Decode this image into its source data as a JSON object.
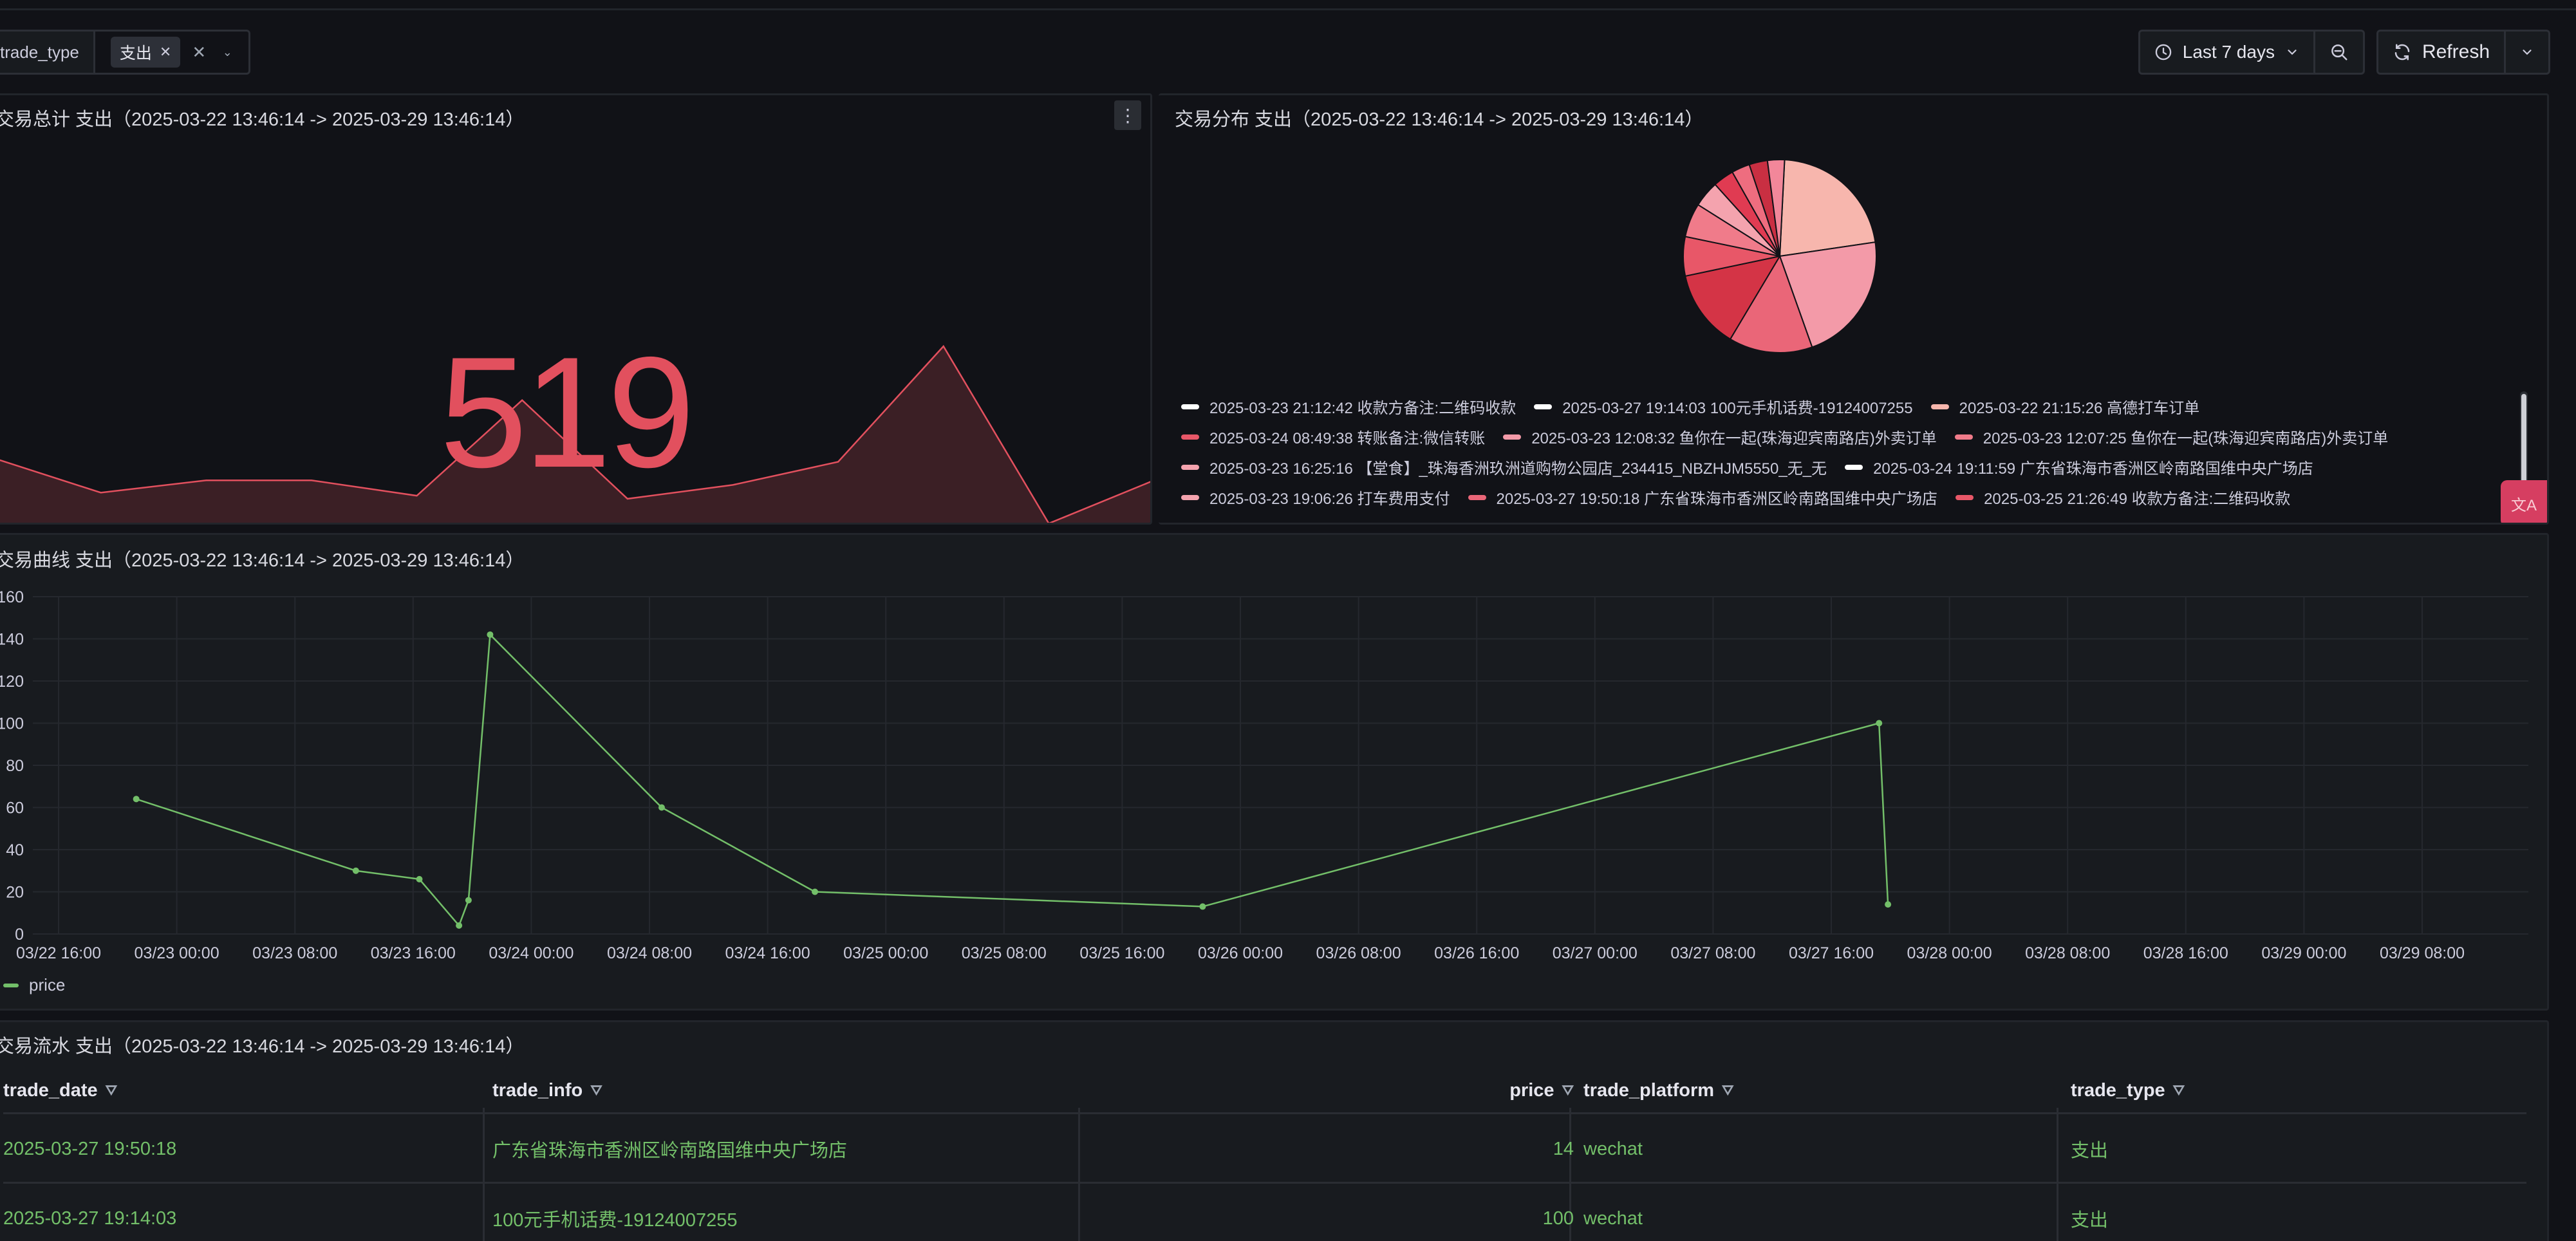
{
  "variable": {
    "name": "trade_type",
    "value": "支出"
  },
  "toolbar": {
    "time_range": "Last 7 days",
    "refresh_label": "Refresh"
  },
  "panels": {
    "stat": {
      "title": "交易总计 支出（2025-03-22 13:46:14 -> 2025-03-29 13:46:14）",
      "value": "519",
      "color": "#e2505e",
      "sparkline": [
        44,
        22,
        30,
        30,
        20,
        82,
        18,
        27,
        42,
        117,
        2,
        30
      ]
    },
    "pie": {
      "title": "交易分布 支出（2025-03-22 13:46:14 -> 2025-03-29 13:46:14）",
      "slices": [
        {
          "label": "2025-03-23 21:12:42 收款方备注:二维码收款",
          "value": 100,
          "color": "#f7b6ad"
        },
        {
          "label": "2025-03-27 19:14:03 100元手机话费-19124007255",
          "value": 100,
          "color": "#f39aa8"
        },
        {
          "label": "2025-03-22 21:15:26 高德打车订单",
          "value": 64,
          "color": "#ea6678"
        },
        {
          "label": "2025-03-24 08:49:38 转账备注:微信转账",
          "value": 60,
          "color": "#d43446"
        },
        {
          "label": "2025-03-23 12:08:32 鱼你在一起(珠海迎宾南路店)外卖订单",
          "value": 30,
          "color": "#e85768"
        },
        {
          "label": "2025-03-23 12:07:25 鱼你在一起(珠海迎宾南路店)外卖订单",
          "value": 26,
          "color": "#f07b8a"
        },
        {
          "label": "2025-03-23 16:25:16 【堂食】_珠海香洲玖洲道购物公园店_234415_NBZHJM5550_无_无",
          "value": 20,
          "color": "#f4a3ae"
        },
        {
          "label": "2025-03-24 19:11:59 广东省珠海市香洲区岭南路国维中央广场店",
          "value": 16,
          "color": "#e03b52"
        },
        {
          "label": "2025-03-23 19:06:26 打车费用支付",
          "value": 14,
          "color": "#ee6d7f"
        },
        {
          "label": "2025-03-27 19:50:18 广东省珠海市香洲区岭南路国维中央广场店",
          "value": 14,
          "color": "#c92f42"
        },
        {
          "label": "2025-03-25 21:26:49 收款方备注:二维码收款",
          "value": 13,
          "color": "#f2879a"
        }
      ],
      "legend_colors": [
        "#ffffff",
        "#ffffff",
        "#f7b6ad",
        "#e85768",
        "#f39aa8",
        "#f07b8a",
        "#f4a3ae",
        "#ffffff",
        "#f4a3ae",
        "#ea6678",
        "#e85768"
      ]
    },
    "line": {
      "title": "交易曲线 支出（2025-03-22 13:46:14 -> 2025-03-29 13:46:14）",
      "series_name": "price",
      "series_color": "#73bf69"
    },
    "table": {
      "title": "交易流水 支出（2025-03-22 13:46:14 -> 2025-03-29 13:46:14）",
      "columns": [
        "trade_date",
        "trade_info",
        "price",
        "trade_platform",
        "trade_type"
      ],
      "rows": [
        [
          "2025-03-27 19:50:18",
          "广东省珠海市香洲区岭南路国维中央广场店",
          "14",
          "wechat",
          "支出"
        ],
        [
          "2025-03-27 19:14:03",
          "100元手机话费-19124007255",
          "100",
          "wechat",
          "支出"
        ]
      ]
    }
  },
  "chart_data": {
    "type": "line",
    "xlabel": "",
    "ylabel": "",
    "ylim": [
      0,
      160
    ],
    "y_ticks": [
      0,
      20,
      40,
      60,
      80,
      100,
      120,
      140,
      160
    ],
    "x_tick_labels": [
      "03/22 16:00",
      "03/23 00:00",
      "03/23 08:00",
      "03/23 16:00",
      "03/24 00:00",
      "03/24 08:00",
      "03/24 16:00",
      "03/25 00:00",
      "03/25 08:00",
      "03/25 16:00",
      "03/26 00:00",
      "03/26 08:00",
      "03/26 16:00",
      "03/27 00:00",
      "03/27 08:00",
      "03/27 16:00",
      "03/28 00:00",
      "03/28 08:00",
      "03/28 16:00",
      "03/29 00:00",
      "03/29 08:00"
    ],
    "series": [
      {
        "name": "price",
        "x": [
          "2025-03-22 21:15:26",
          "2025-03-23 12:07:25",
          "2025-03-23 16:25:16",
          "2025-03-23 19:06:26",
          "2025-03-23 19:45:00",
          "2025-03-23 21:12:42",
          "2025-03-24 08:49:38",
          "2025-03-24 19:11:59",
          "2025-03-25 21:26:49",
          "2025-03-27 19:14:03",
          "2025-03-27 19:50:18"
        ],
        "values": [
          64,
          30,
          26,
          4,
          16,
          142,
          60,
          20,
          13,
          100,
          14
        ]
      }
    ]
  }
}
